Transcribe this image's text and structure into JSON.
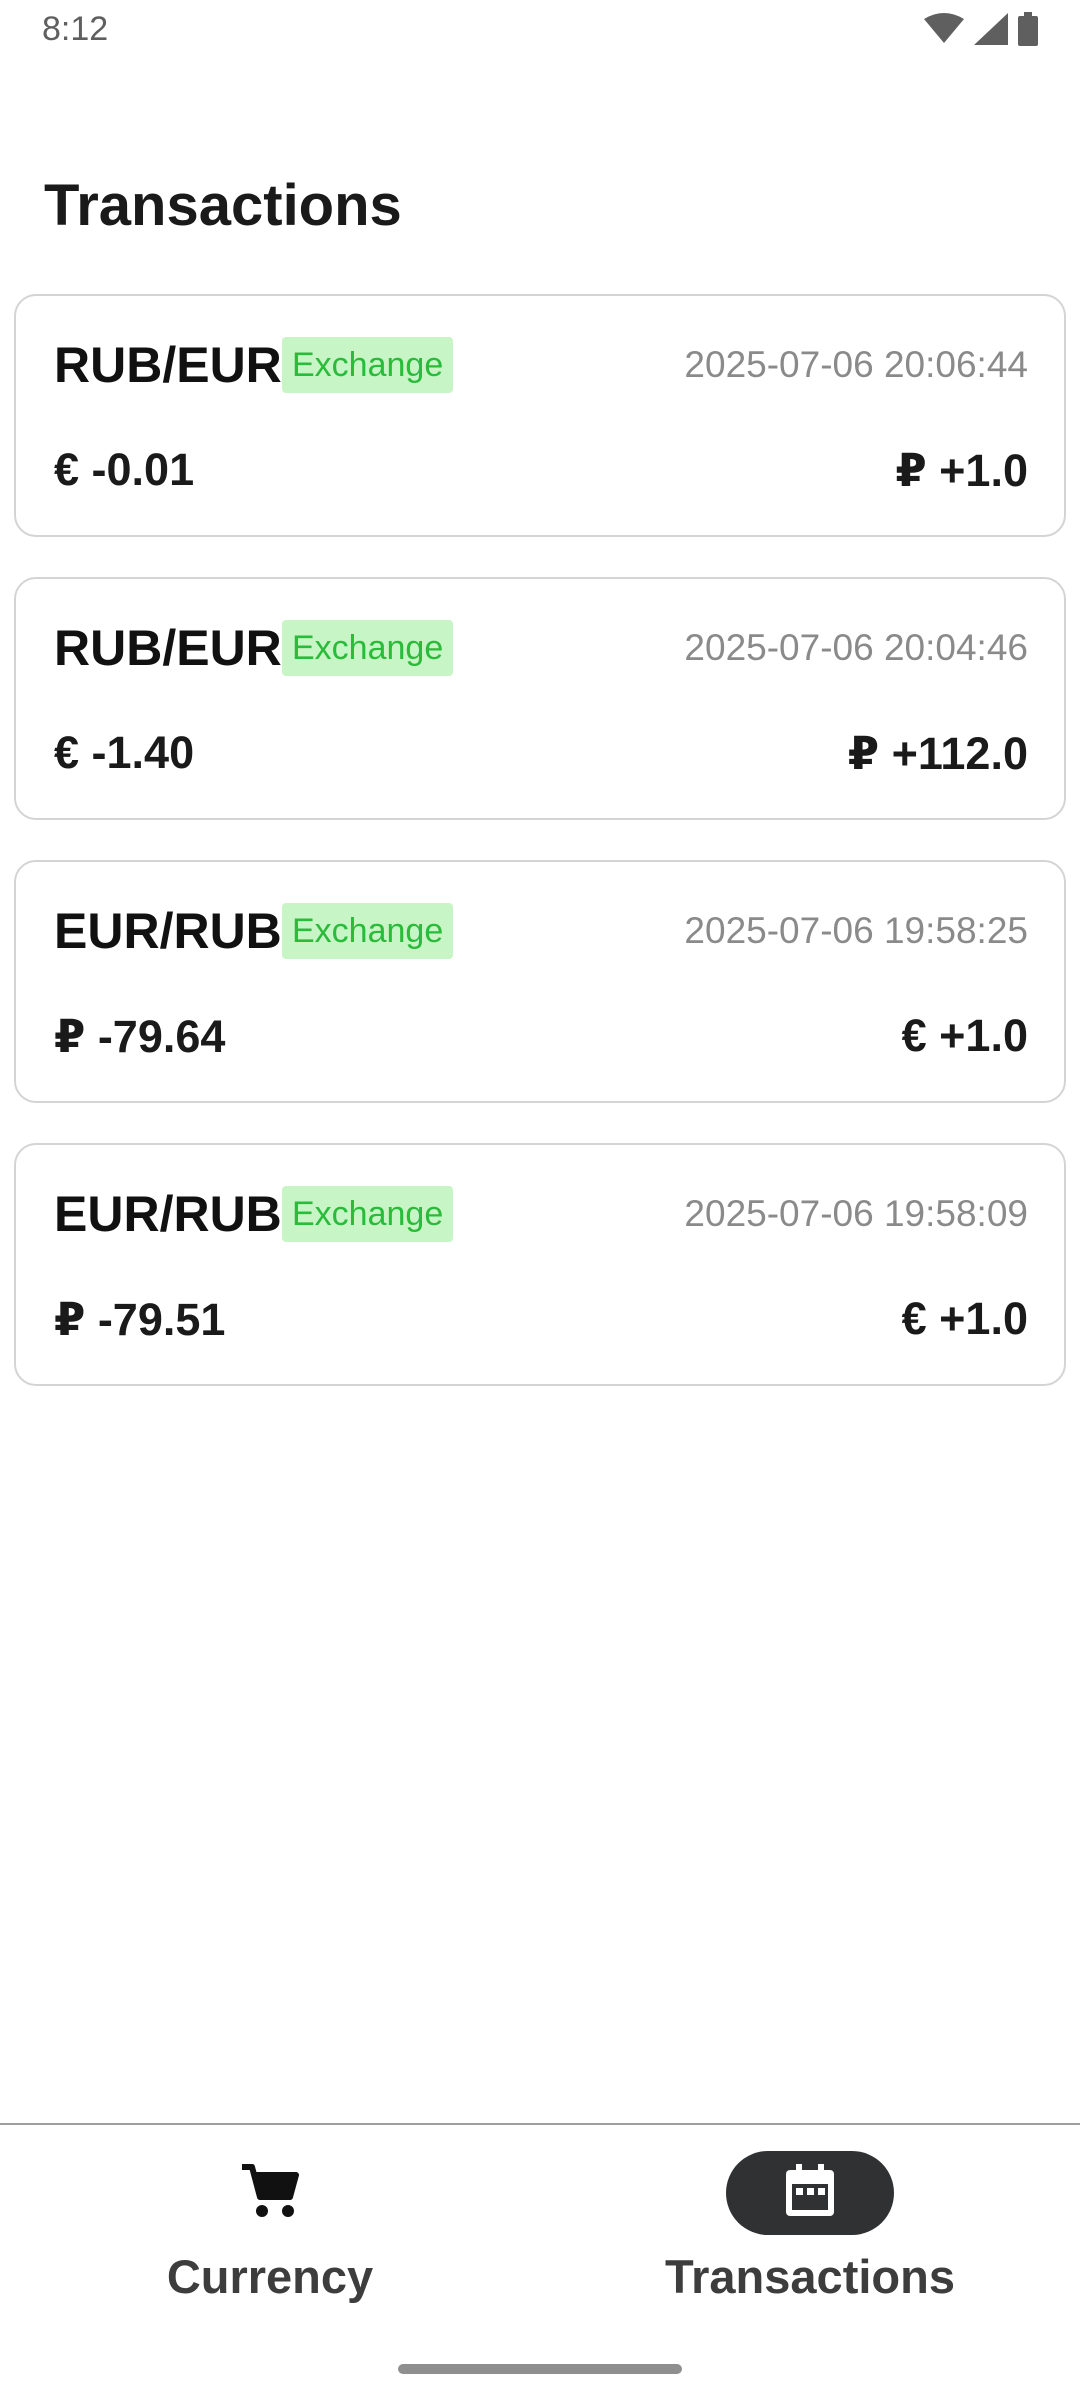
{
  "status_bar": {
    "time": "8:12",
    "icons": [
      "wifi-icon",
      "cellular-signal-icon",
      "battery-icon"
    ]
  },
  "header": {
    "title": "Transactions"
  },
  "transactions": [
    {
      "pair": "RUB/EUR",
      "type": "Exchange",
      "datetime": "2025-07-06 20:06:44",
      "debit": "€ -0.01",
      "credit": "₽ +1.0"
    },
    {
      "pair": "RUB/EUR",
      "type": "Exchange",
      "datetime": "2025-07-06 20:04:46",
      "debit": "€ -1.40",
      "credit": "₽ +112.0"
    },
    {
      "pair": "EUR/RUB",
      "type": "Exchange",
      "datetime": "2025-07-06 19:58:25",
      "debit": "₽ -79.64",
      "credit": "€ +1.0"
    },
    {
      "pair": "EUR/RUB",
      "type": "Exchange",
      "datetime": "2025-07-06 19:58:09",
      "debit": "₽ -79.51",
      "credit": "€ +1.0"
    }
  ],
  "bottom_nav": {
    "items": [
      {
        "label": "Currency",
        "icon": "shopping-cart-icon",
        "active": false
      },
      {
        "label": "Transactions",
        "icon": "calendar-icon",
        "active": true
      }
    ]
  },
  "colors": {
    "badge_background": "#c8f5c6",
    "badge_text": "#2bbb3a",
    "active_nav_pill": "#2f3133",
    "card_border": "#d4d4d4"
  }
}
